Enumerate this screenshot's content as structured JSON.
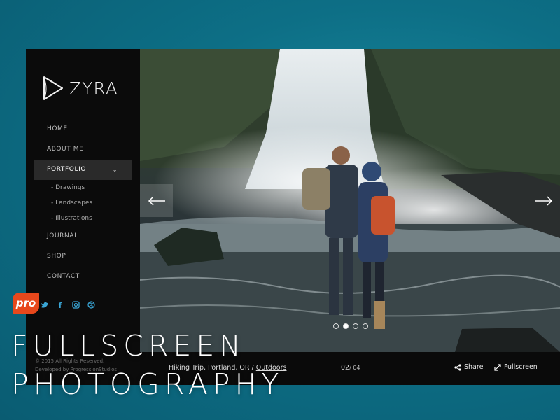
{
  "brand": {
    "name": "ZYRA"
  },
  "nav": {
    "items": [
      {
        "label": "HOME"
      },
      {
        "label": "ABOUT ME"
      },
      {
        "label": "PORTFOLIO"
      },
      {
        "label": "JOURNAL"
      },
      {
        "label": "SHOP"
      },
      {
        "label": "CONTACT"
      }
    ],
    "portfolio_sub": [
      {
        "label": "- Drawings"
      },
      {
        "label": "- Landscapes"
      },
      {
        "label": "- Illustrations"
      }
    ]
  },
  "socials": [
    "twitter-icon",
    "facebook-icon",
    "instagram-icon",
    "dribbble-icon"
  ],
  "footer": {
    "copyright": "© 2015 All Rights Reserved.",
    "developer": "Developed by ProgressionStudios"
  },
  "slide": {
    "caption": "Hiking Trip, Portland, OR / ",
    "category": "Outdoors",
    "current": "02",
    "total": "/ 04",
    "dots_count": 4,
    "active_dot": 2
  },
  "actions": {
    "share_label": "Share",
    "fullscreen_label": "Fullscreen"
  },
  "promo": {
    "badge": "pro",
    "line1": "FULLSCREEN",
    "line2": "PHOTOGRAPHY"
  },
  "colors": {
    "accent": "#e8481c",
    "social": "#3aa6d6",
    "background": "#0d6f86"
  }
}
